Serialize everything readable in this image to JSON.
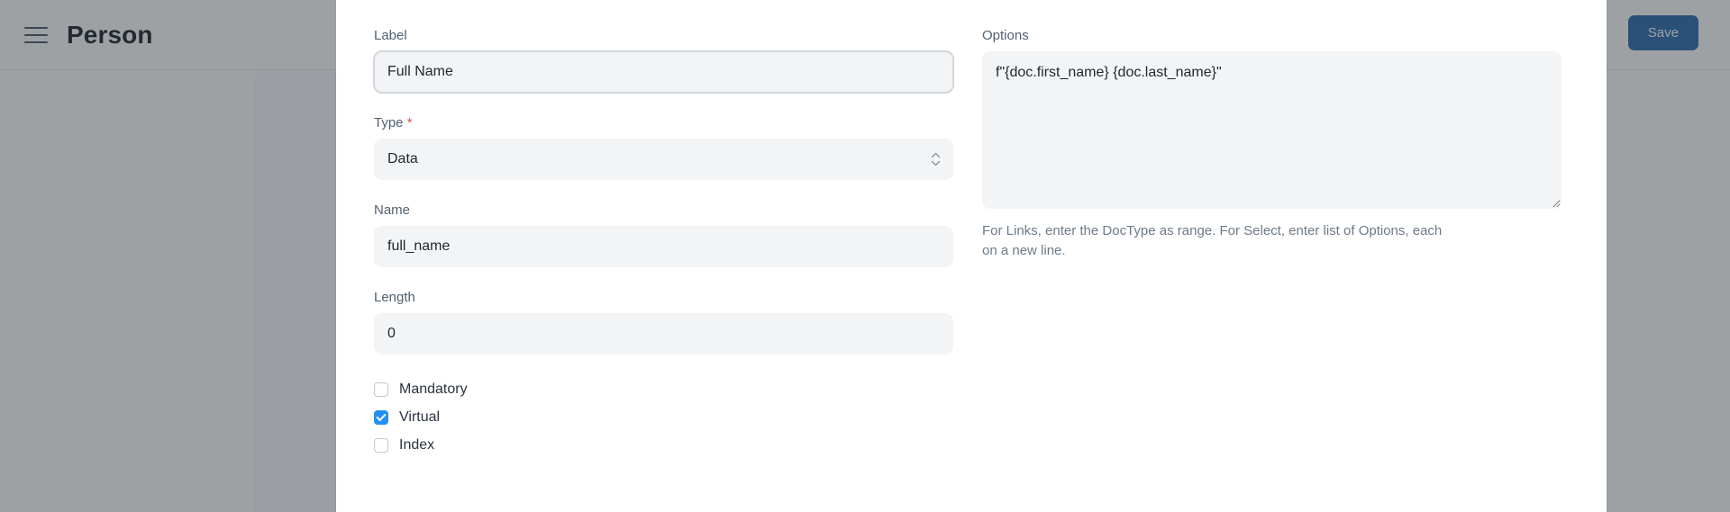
{
  "app": {
    "title": "Person",
    "menu_icon": "hamburger-icon",
    "save_label": "Save"
  },
  "modal": {
    "left_column": {
      "label_field": {
        "label": "Label",
        "value": "Full Name",
        "placeholder": ""
      },
      "type_field": {
        "label": "Type",
        "required": true,
        "required_marker": "*",
        "value": "Data",
        "options": [
          "Data"
        ],
        "chevron_icon": "chevron-up-down-icon"
      },
      "name_field": {
        "label": "Name",
        "value": "full_name",
        "placeholder": ""
      },
      "length_field": {
        "label": "Length",
        "value": "0",
        "placeholder": ""
      },
      "checkboxes": [
        {
          "label": "Mandatory",
          "checked": false
        },
        {
          "label": "Virtual",
          "checked": true
        },
        {
          "label": "Index",
          "checked": false
        }
      ]
    },
    "right_column": {
      "options_field": {
        "label": "Options",
        "value": "f\"{doc.first_name} {doc.last_name}\"",
        "help": "For Links, enter the DocType as range. For Select, enter list of Options, each on a new line.",
        "resize_handle_icon": "resize-handle-icon"
      }
    }
  },
  "colors": {
    "accent": "#2490ef",
    "primary_button": "#2d6cb0",
    "required": "#e24c4c",
    "field_background": "#f3f4f6",
    "overlay": "rgba(40,46,54,0.45)"
  }
}
